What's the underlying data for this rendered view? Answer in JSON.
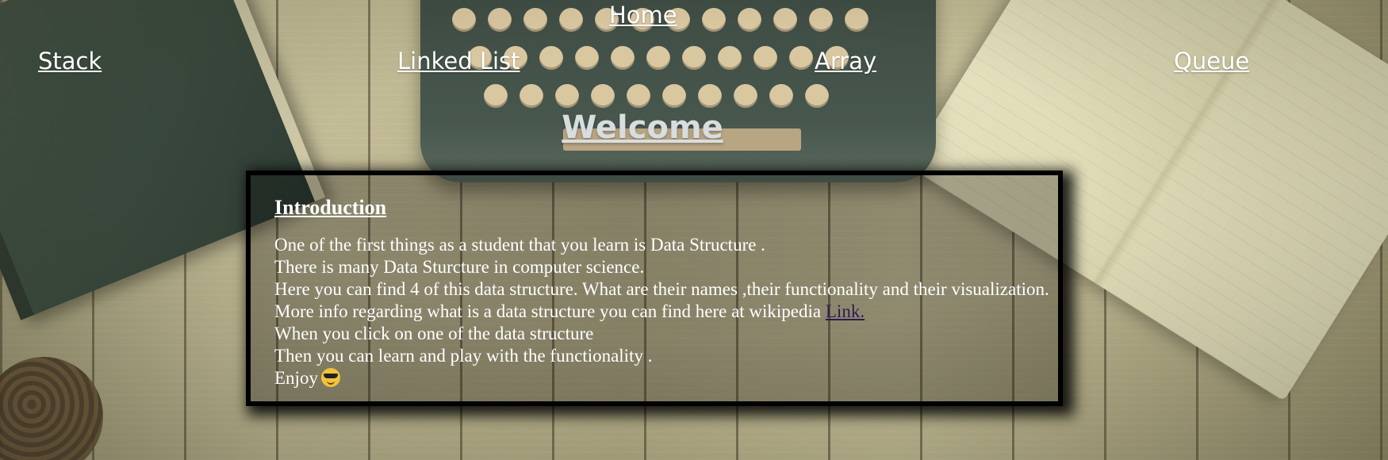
{
  "nav": {
    "home": "Home",
    "stack": "Stack",
    "linked_list": "Linked List",
    "array": "Array",
    "queue": "Queue"
  },
  "heading": "Welcome",
  "intro": {
    "title": "Introduction",
    "line1": "One of the first things as a student that you learn is Data Structure .",
    "line2": "There is many Data Sturcture in computer science.",
    "line3": "Here you can find 4 of this data structure. What are their names ,their functionality and their visualization.",
    "line4_text": "More info regarding what is a data structure you can find here at wikipedia ",
    "line4_link": "Link.",
    "line5": "When you click on one of the data structure",
    "line6": "Then you can learn and play with the functionality .",
    "line7": "Enjoy"
  },
  "icons": {
    "emoji": "smiling-face-with-sunglasses-icon"
  },
  "colors": {
    "link": "#ffffff",
    "visited_link": "#2e1a52",
    "heading": "#d8dde0",
    "panel_border": "#000000"
  }
}
